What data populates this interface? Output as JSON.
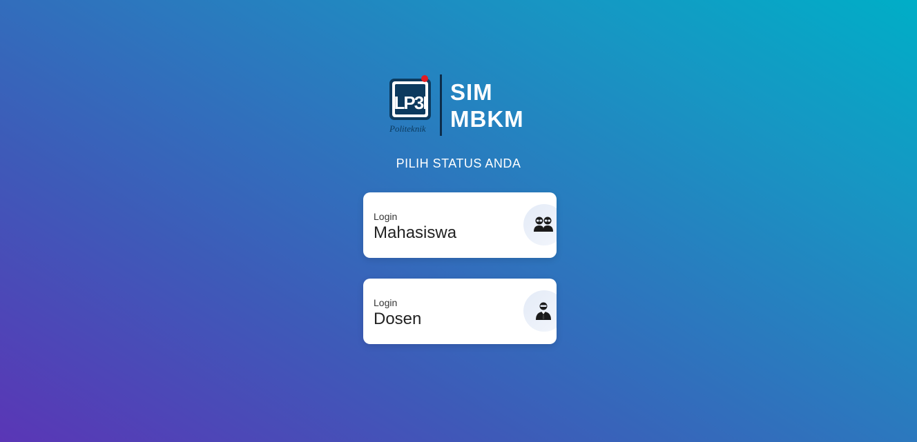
{
  "brand": {
    "logo_text": "LP3I",
    "logo_caption": "Politeknik",
    "title_line1": "SIM",
    "title_line2": "MBKM"
  },
  "subtitle": "PILIH STATUS ANDA",
  "options": [
    {
      "small_label": "Login",
      "label": "Mahasiswa",
      "icon": "students-icon"
    },
    {
      "small_label": "Login",
      "label": "Dosen",
      "icon": "lecturer-icon"
    }
  ],
  "colors": {
    "gradient_start": "#5a36b6",
    "gradient_end": "#00aec7",
    "logo_navy": "#0c3a5e",
    "logo_dot": "#e11b22"
  }
}
